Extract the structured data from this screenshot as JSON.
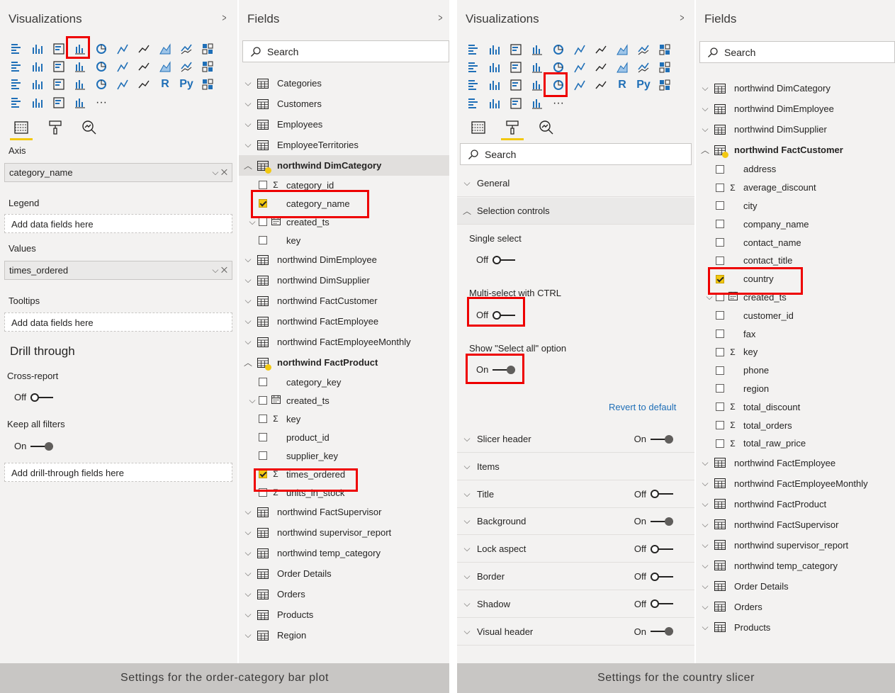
{
  "left": {
    "visualizations": {
      "title": "Visualizations",
      "tabs": [
        "fields-tab-icon",
        "format-tab-icon",
        "analytics-tab-icon"
      ],
      "wells": [
        {
          "label": "Axis",
          "value": "category_name",
          "filled": true
        },
        {
          "label": "Legend",
          "value": "Add data fields here",
          "filled": false
        },
        {
          "label": "Values",
          "value": "times_ordered",
          "filled": true
        },
        {
          "label": "Tooltips",
          "value": "Add data fields here",
          "filled": false
        }
      ],
      "drill": {
        "title": "Drill through",
        "cross_report_label": "Cross-report",
        "cross_report_state": "Off",
        "keep_filters_label": "Keep all filters",
        "keep_filters_state": "On",
        "drill_placeholder": "Add drill-through fields here"
      }
    },
    "fields": {
      "title": "Fields",
      "search_placeholder": "Search",
      "tables": [
        {
          "name": "Categories"
        },
        {
          "name": "Customers"
        },
        {
          "name": "Employees"
        },
        {
          "name": "EmployeeTerritories"
        },
        {
          "name": "northwind DimCategory",
          "expanded": true,
          "checked": true
        },
        {
          "name": "northwind DimEmployee"
        },
        {
          "name": "northwind DimSupplier"
        },
        {
          "name": "northwind FactCustomer"
        },
        {
          "name": "northwind FactEmployee"
        },
        {
          "name": "northwind FactEmployeeMonthly"
        },
        {
          "name": "northwind FactProduct",
          "expanded": true,
          "checked": true
        },
        {
          "name": "northwind FactSupervisor"
        },
        {
          "name": "northwind supervisor_report"
        },
        {
          "name": "northwind temp_category"
        },
        {
          "name": "Order Details"
        },
        {
          "name": "Orders"
        },
        {
          "name": "Products"
        },
        {
          "name": "Region"
        }
      ],
      "dimcategory_fields": [
        {
          "name": "category_id",
          "sigma": true
        },
        {
          "name": "category_name",
          "checked": true
        },
        {
          "name": "created_ts",
          "date": true,
          "expand": true
        },
        {
          "name": "key"
        }
      ],
      "factproduct_fields": [
        {
          "name": "category_key"
        },
        {
          "name": "created_ts",
          "date": true,
          "expand": true
        },
        {
          "name": "key",
          "sigma": true
        },
        {
          "name": "product_id"
        },
        {
          "name": "supplier_key"
        },
        {
          "name": "times_ordered",
          "sigma": true,
          "checked": true
        },
        {
          "name": "units_in_stock",
          "sigma": true
        }
      ]
    },
    "caption": "Settings for the order-category bar plot"
  },
  "right": {
    "visualizations": {
      "title": "Visualizations",
      "search_placeholder": "Search",
      "general_label": "General",
      "selection_label": "Selection controls",
      "single_select_label": "Single select",
      "single_select_state": "Off",
      "multi_select_label": "Multi-select with CTRL",
      "multi_select_state": "Off",
      "select_all_label": "Show \"Select all\" option",
      "select_all_state": "On",
      "revert_label": "Revert to default",
      "sections": [
        {
          "label": "Slicer header",
          "state": "On"
        },
        {
          "label": "Items",
          "state": ""
        },
        {
          "label": "Title",
          "state": "Off"
        },
        {
          "label": "Background",
          "state": "On"
        },
        {
          "label": "Lock aspect",
          "state": "Off"
        },
        {
          "label": "Border",
          "state": "Off"
        },
        {
          "label": "Shadow",
          "state": "Off"
        },
        {
          "label": "Visual header",
          "state": "On"
        }
      ]
    },
    "fields": {
      "title": "Fields",
      "search_placeholder": "Search",
      "tables_before": [
        "northwind DimCategory",
        "northwind DimEmployee",
        "northwind DimSupplier"
      ],
      "expanded_table": "northwind FactCustomer",
      "customer_fields": [
        {
          "name": "address"
        },
        {
          "name": "average_discount",
          "sigma": true
        },
        {
          "name": "city"
        },
        {
          "name": "company_name"
        },
        {
          "name": "contact_name"
        },
        {
          "name": "contact_title"
        },
        {
          "name": "country",
          "checked": true
        },
        {
          "name": "created_ts",
          "date": true,
          "expand": true
        },
        {
          "name": "customer_id"
        },
        {
          "name": "fax"
        },
        {
          "name": "key",
          "sigma": true
        },
        {
          "name": "phone"
        },
        {
          "name": "region"
        },
        {
          "name": "total_discount",
          "sigma": true
        },
        {
          "name": "total_orders",
          "sigma": true
        },
        {
          "name": "total_raw_price",
          "sigma": true
        }
      ],
      "tables_after": [
        "northwind FactEmployee",
        "northwind FactEmployeeMonthly",
        "northwind FactProduct",
        "northwind FactSupervisor",
        "northwind supervisor_report",
        "northwind temp_category",
        "Order Details",
        "Orders",
        "Products"
      ]
    },
    "caption": "Settings for the country slicer"
  },
  "colors": {
    "accent": "#f2c811",
    "highlight": "#ee0000",
    "link": "#1f6fb7",
    "panel": "#f3f2f1"
  }
}
